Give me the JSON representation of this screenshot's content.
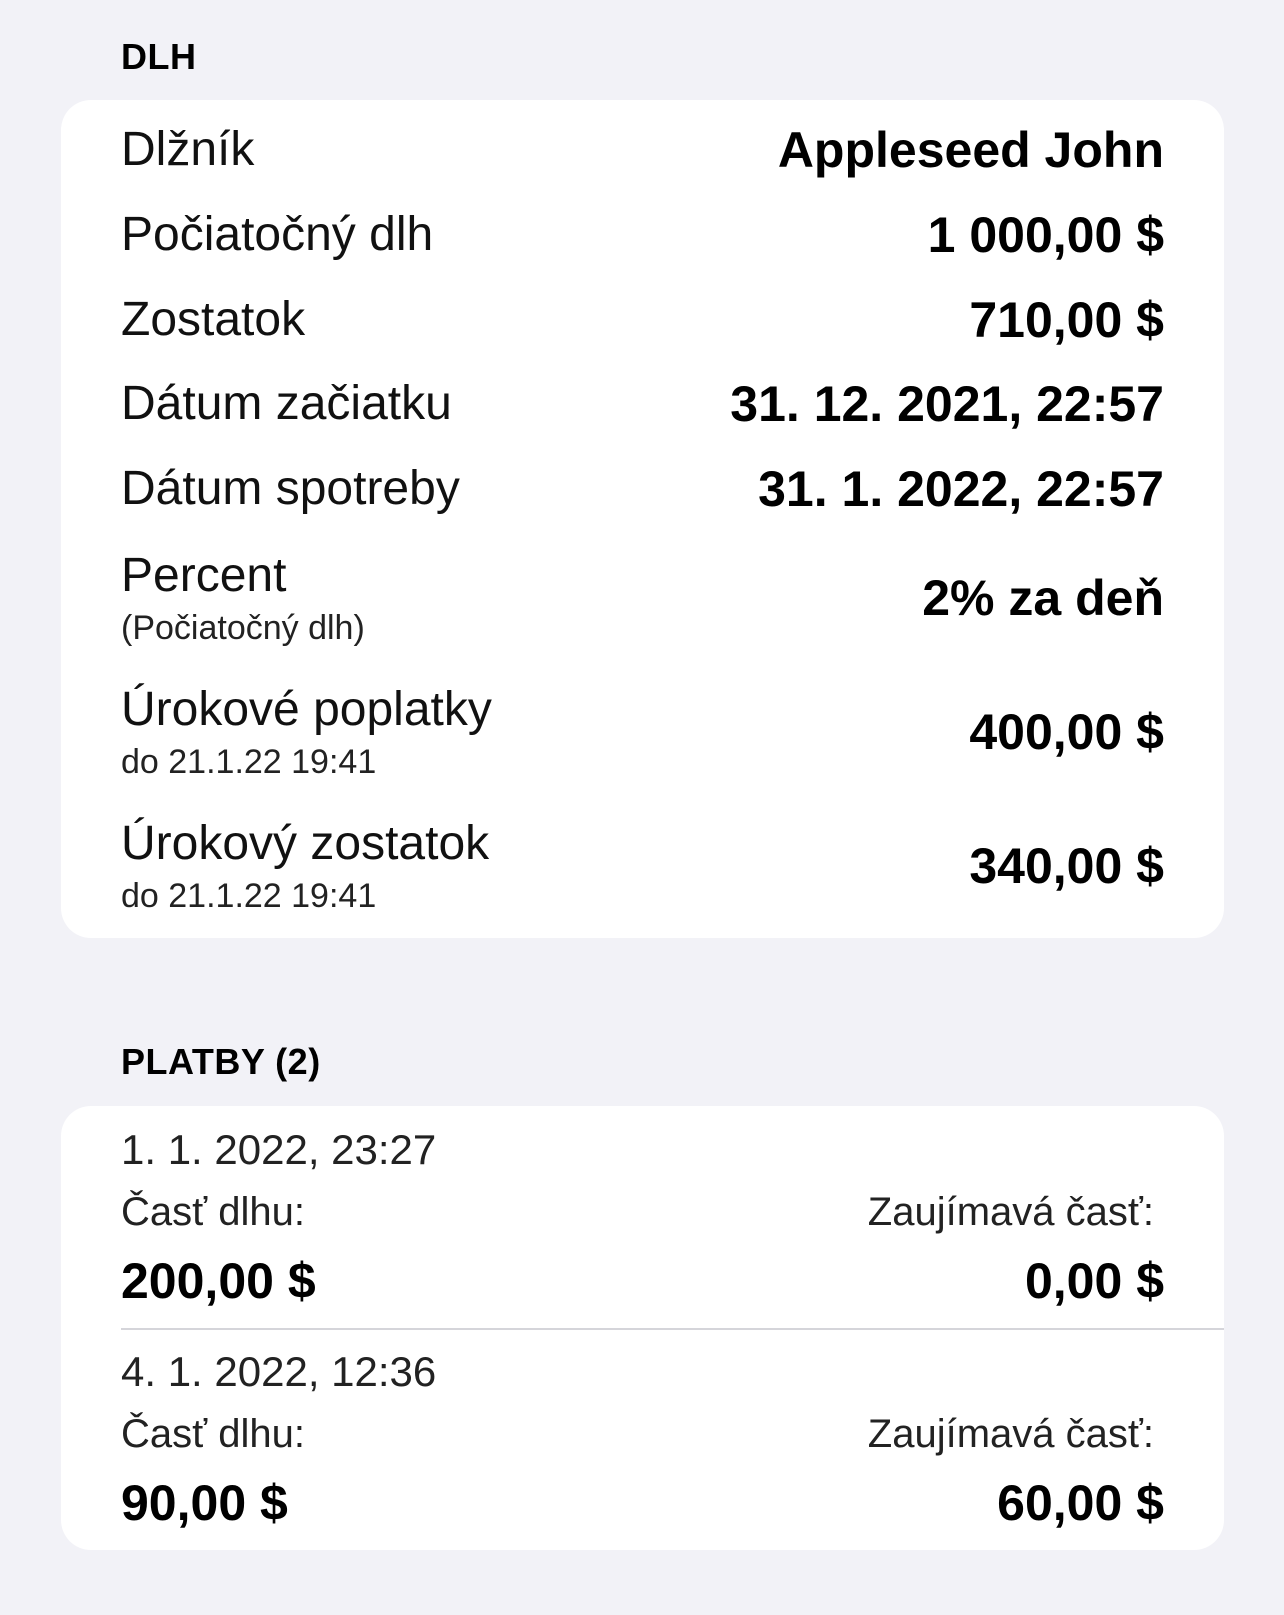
{
  "debt_section": {
    "title": "DLH",
    "rows": [
      {
        "label": "Dlžník",
        "sub": "",
        "value": "Appleseed John"
      },
      {
        "label": "Počiatočný dlh",
        "sub": "",
        "value": "1 000,00 $"
      },
      {
        "label": "Zostatok",
        "sub": "",
        "value": "710,00 $"
      },
      {
        "label": "Dátum začiatku",
        "sub": "",
        "value": "31. 12. 2021, 22:57"
      },
      {
        "label": "Dátum spotreby",
        "sub": "",
        "value": "31. 1. 2022, 22:57"
      },
      {
        "label": "Percent",
        "sub": "(Počiatočný dlh)",
        "value": "2% za deň"
      },
      {
        "label": "Úrokové poplatky",
        "sub": "do 21.1.22 19:41",
        "value": "400,00 $"
      },
      {
        "label": "Úrokový zostatok",
        "sub": "do 21.1.22 19:41",
        "value": "340,00 $"
      }
    ]
  },
  "payments_section": {
    "title": "PLATBY (2)",
    "payments": [
      {
        "date": "1. 1. 2022, 23:27",
        "debt_part_label": "Časť dlhu:",
        "debt_part_value": "200,00 $",
        "interest_part_label": "Zaujímavá časť:",
        "interest_part_value": "0,00 $"
      },
      {
        "date": "4. 1. 2022, 12:36",
        "debt_part_label": "Časť dlhu:",
        "debt_part_value": "90,00 $",
        "interest_part_label": "Zaujímavá časť:",
        "interest_part_value": "60,00 $"
      }
    ]
  }
}
